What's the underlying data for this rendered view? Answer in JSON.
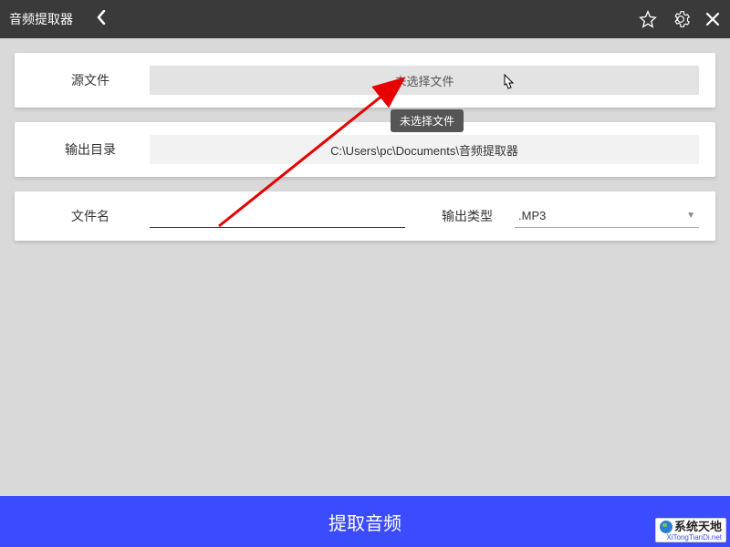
{
  "header": {
    "title": "音频提取器"
  },
  "panels": {
    "source_label": "源文件",
    "source_placeholder": "未选择文件",
    "tooltip": "未选择文件",
    "output_dir_label": "输出目录",
    "output_dir_value": "C:\\Users\\pc\\Documents\\音频提取器",
    "filename_label": "文件名",
    "filename_value": "",
    "output_type_label": "输出类型",
    "output_type_value": ".MP3"
  },
  "action": {
    "extract_label": "提取音频"
  },
  "watermark": {
    "main": "系统天地",
    "sub": "XiTongTianDi.net"
  }
}
